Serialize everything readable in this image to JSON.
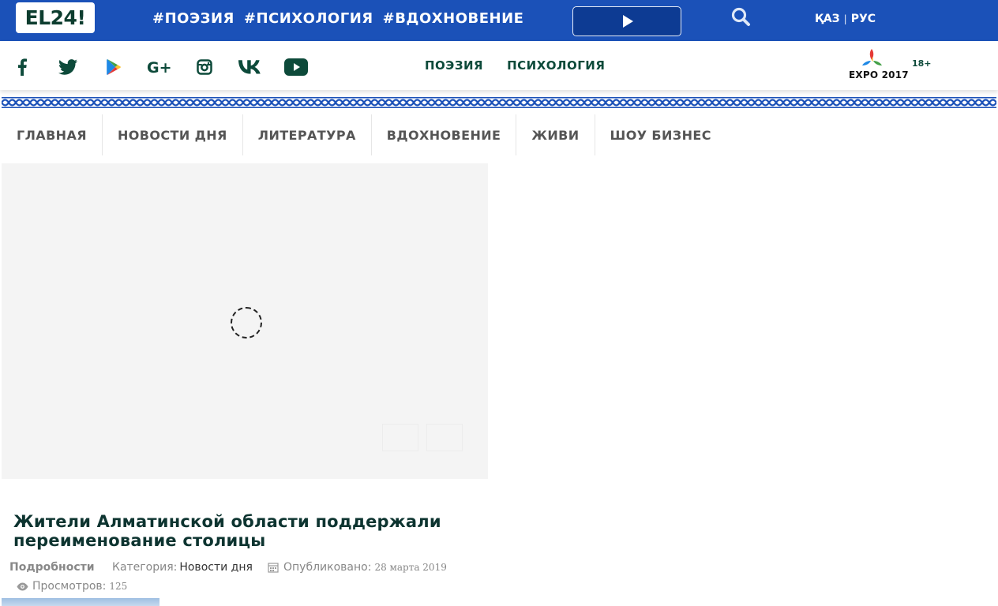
{
  "header": {
    "logo_text": "EL24!",
    "hashtags": [
      "#ПОЭЗИЯ",
      "#ПСИХОЛОГИЯ",
      "#ВДОХНОВЕНИЕ"
    ],
    "lang_kaz": "ҚАЗ",
    "lang_sep": "|",
    "lang_rus": "РУС",
    "brand_color": "#1b51b8",
    "play_icon": "play-icon",
    "search_icon": "search-icon"
  },
  "social": {
    "icons": [
      "facebook-icon",
      "twitter-icon",
      "google-play-icon",
      "google-plus-icon",
      "instagram-icon",
      "vk-icon",
      "youtube-icon"
    ],
    "links": [
      "ПОЭЗИЯ",
      "ПСИХОЛОГИЯ"
    ],
    "expo_label": "EXPO 2017",
    "age_rating": "18+",
    "accent_color": "#0d4a3a"
  },
  "menu": {
    "items": [
      "ГЛАВНАЯ",
      "НОВОСТИ ДНЯ",
      "ЛИТЕРАТУРА",
      "ВДОХНОВЕНИЕ",
      "ЖИВИ",
      "ШОУ БИЗНЕС"
    ]
  },
  "article": {
    "title": "Жители Алматинской области поддержали переименование столицы",
    "details_label": "Подробности",
    "category_label": "Категория:",
    "category_value": "Новости дня",
    "published_label": "Опубликовано:",
    "published_date": "28 марта 2019",
    "views_label": "Просмотров:",
    "views_count": "125"
  }
}
